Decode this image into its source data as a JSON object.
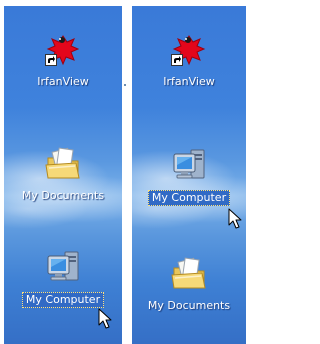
{
  "desktop_before": {
    "icons": [
      {
        "id": "irfanview",
        "label": "IrfanView",
        "icon": "irfanview-icon",
        "shortcut": true,
        "selected": false
      },
      {
        "id": "my-documents",
        "label": "My Documents",
        "icon": "folder-documents-icon",
        "shortcut": false,
        "selected": false
      },
      {
        "id": "my-computer",
        "label": "My Computer",
        "icon": "computer-icon",
        "shortcut": false,
        "selected": true
      }
    ]
  },
  "desktop_after": {
    "icons": [
      {
        "id": "irfanview",
        "label": "IrfanView",
        "icon": "irfanview-icon",
        "shortcut": true,
        "selected": false
      },
      {
        "id": "my-computer",
        "label": "My Computer",
        "icon": "computer-icon",
        "shortcut": false,
        "selected": true
      },
      {
        "id": "my-documents",
        "label": "My Documents",
        "icon": "folder-documents-icon",
        "shortcut": false,
        "selected": false
      }
    ]
  },
  "colors": {
    "selection": "#316ac5",
    "desktop_blue": "#3f82dc",
    "irfanview_red": "#e3061b"
  }
}
